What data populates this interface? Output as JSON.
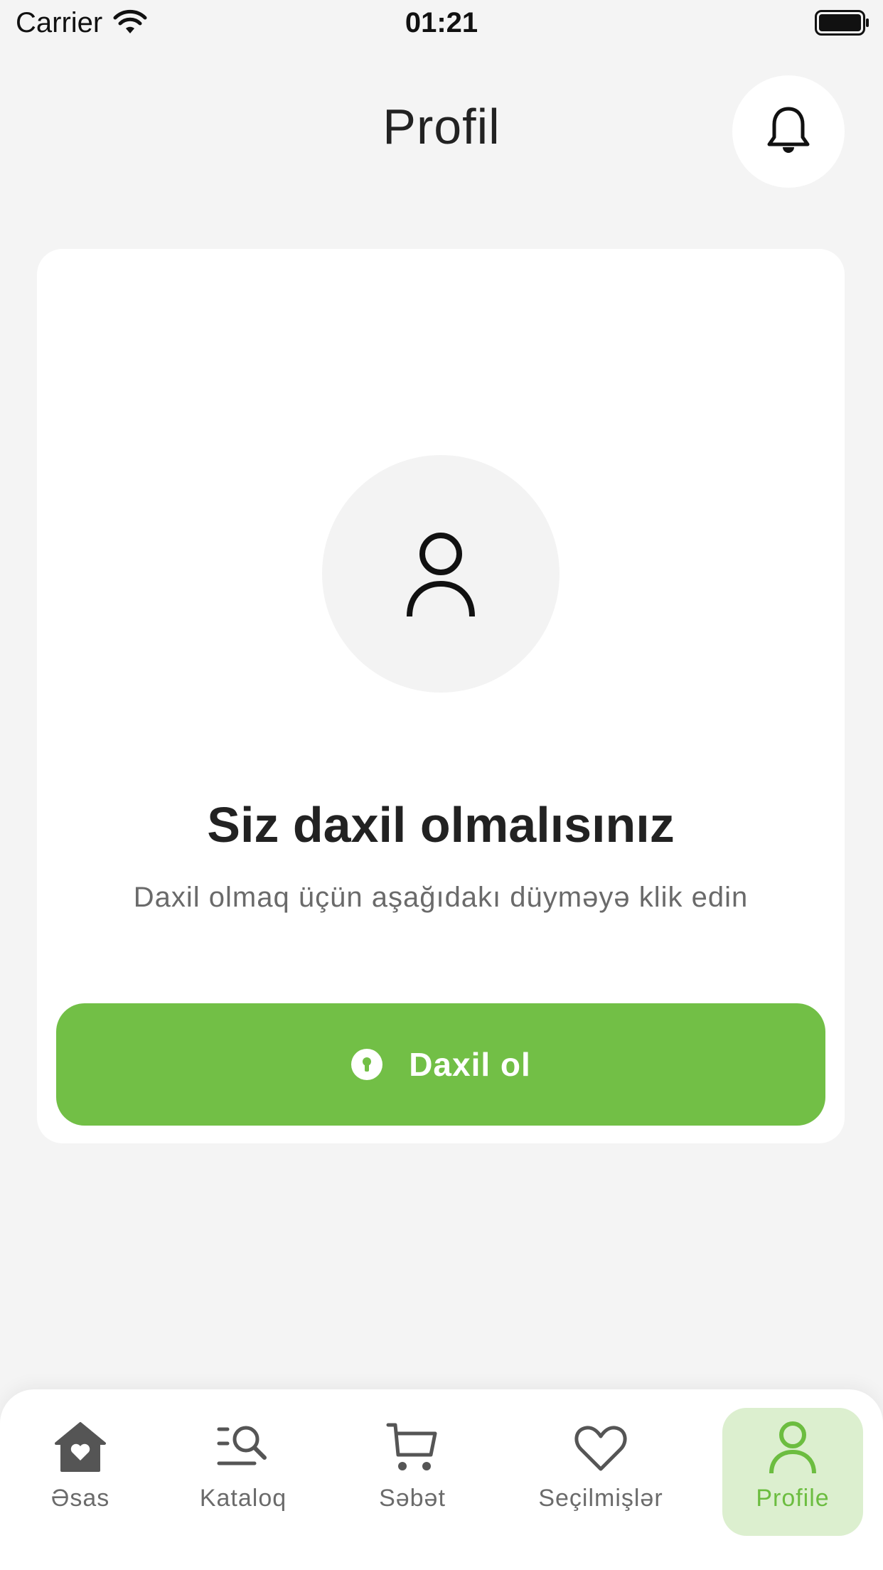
{
  "status_bar": {
    "carrier": "Carrier",
    "time": "01:21"
  },
  "header": {
    "title": "Profil",
    "notification_icon": "bell-icon"
  },
  "card": {
    "avatar_icon": "user-icon",
    "title": "Siz daxil olmalısınız",
    "subtitle": "Daxil olmaq üçün aşağıdakı düyməyə klik edin",
    "login_button": {
      "label": "Daxil ol",
      "icon": "keyhole-icon"
    }
  },
  "bottom_nav": {
    "items": [
      {
        "label": "Əsas",
        "icon": "home-heart-icon",
        "active": false
      },
      {
        "label": "Kataloq",
        "icon": "catalog-search-icon",
        "active": false
      },
      {
        "label": "Səbət",
        "icon": "cart-icon",
        "active": false
      },
      {
        "label": "Seçilmişlər",
        "icon": "heart-icon",
        "active": false
      },
      {
        "label": "Profile",
        "icon": "profile-icon",
        "active": true
      }
    ]
  },
  "colors": {
    "accent": "#72bf46",
    "accent_light": "#dcefcf",
    "background": "#f4f4f4"
  }
}
